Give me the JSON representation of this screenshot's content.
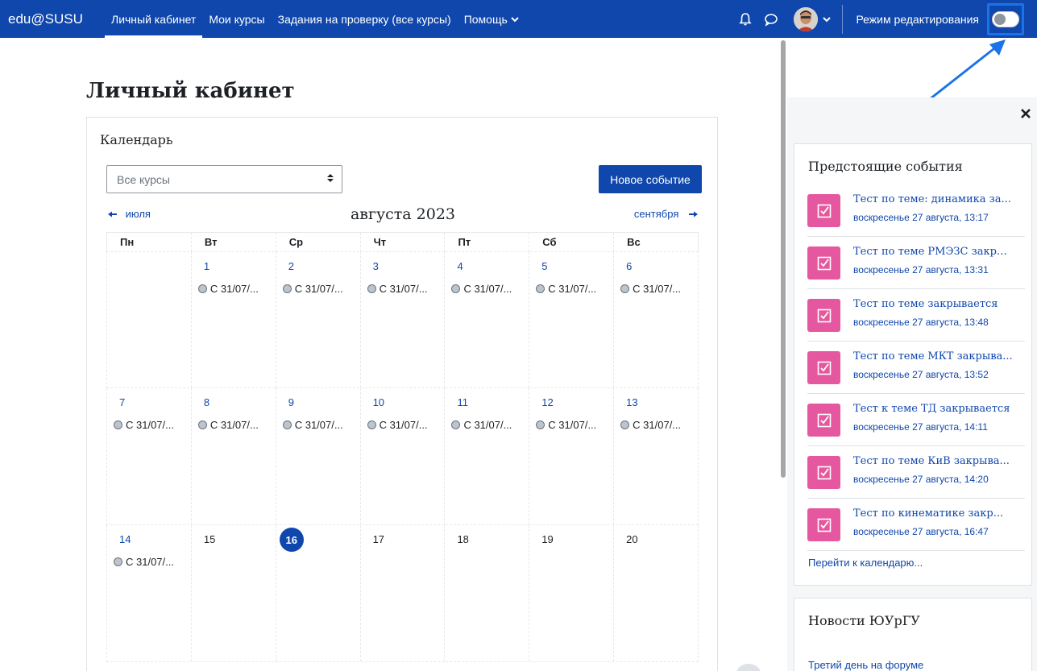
{
  "navbar": {
    "brand": "edu@SUSU",
    "items": [
      {
        "label": "Личный кабинет"
      },
      {
        "label": "Мои курсы"
      },
      {
        "label": "Задания на проверку (все курсы)"
      },
      {
        "label": "Помощь"
      }
    ],
    "edit_mode_label": "Режим редактирования"
  },
  "page": {
    "title": "Личный кабинет"
  },
  "calendar": {
    "title": "Календарь",
    "course_select": "Все курсы",
    "new_event": "Новое событие",
    "prev_month": "июля",
    "next_month": "сентября",
    "month": "августа 2023",
    "weekdays": [
      "Пн",
      "Вт",
      "Ср",
      "Чт",
      "Пт",
      "Сб",
      "Вс"
    ],
    "event_label": "С 31/07/...",
    "days": {
      "d1": "1",
      "d2": "2",
      "d3": "3",
      "d4": "4",
      "d5": "5",
      "d6": "6",
      "d7": "7",
      "d8": "8",
      "d9": "9",
      "d10": "10",
      "d11": "11",
      "d12": "12",
      "d13": "13",
      "d14": "14",
      "d15": "15",
      "d16": "16",
      "d17": "17",
      "d18": "18",
      "d19": "19",
      "d20": "20"
    }
  },
  "upcoming": {
    "title": "Предстоящие события",
    "events": [
      {
        "name": "Тест по теме: динамика за...",
        "date": "воскресенье 27 августа, 13:17"
      },
      {
        "name": "Тест по теме РМЭЗС закры...",
        "date": "воскресенье 27 августа, 13:31"
      },
      {
        "name": "Тест по теме закрывается",
        "date": "воскресенье 27 августа, 13:48"
      },
      {
        "name": "Тест по теме МКТ закрыва...",
        "date": "воскресенье 27 августа, 13:52"
      },
      {
        "name": "Тест к теме ТД закрывается",
        "date": "воскресенье 27 августа, 14:11"
      },
      {
        "name": "Тест по теме КиВ закрыва...",
        "date": "воскресенье 27 августа, 14:20"
      },
      {
        "name": "Тест по кинематике закр...",
        "date": "воскресенье 27 августа, 16:47"
      }
    ],
    "goto_calendar": "Перейти к календарю..."
  },
  "news": {
    "title": "Новости ЮУрГУ",
    "first_item": "Третий день на форуме"
  },
  "icons": {
    "bell": "bell-icon",
    "messages": "chat-icon",
    "close": "close-icon",
    "quiz": "quiz-checkbox-icon"
  },
  "colors": {
    "primary": "#0f47ad",
    "quiz_icon_bg": "#e5589f",
    "highlight": "#1a73e8"
  }
}
